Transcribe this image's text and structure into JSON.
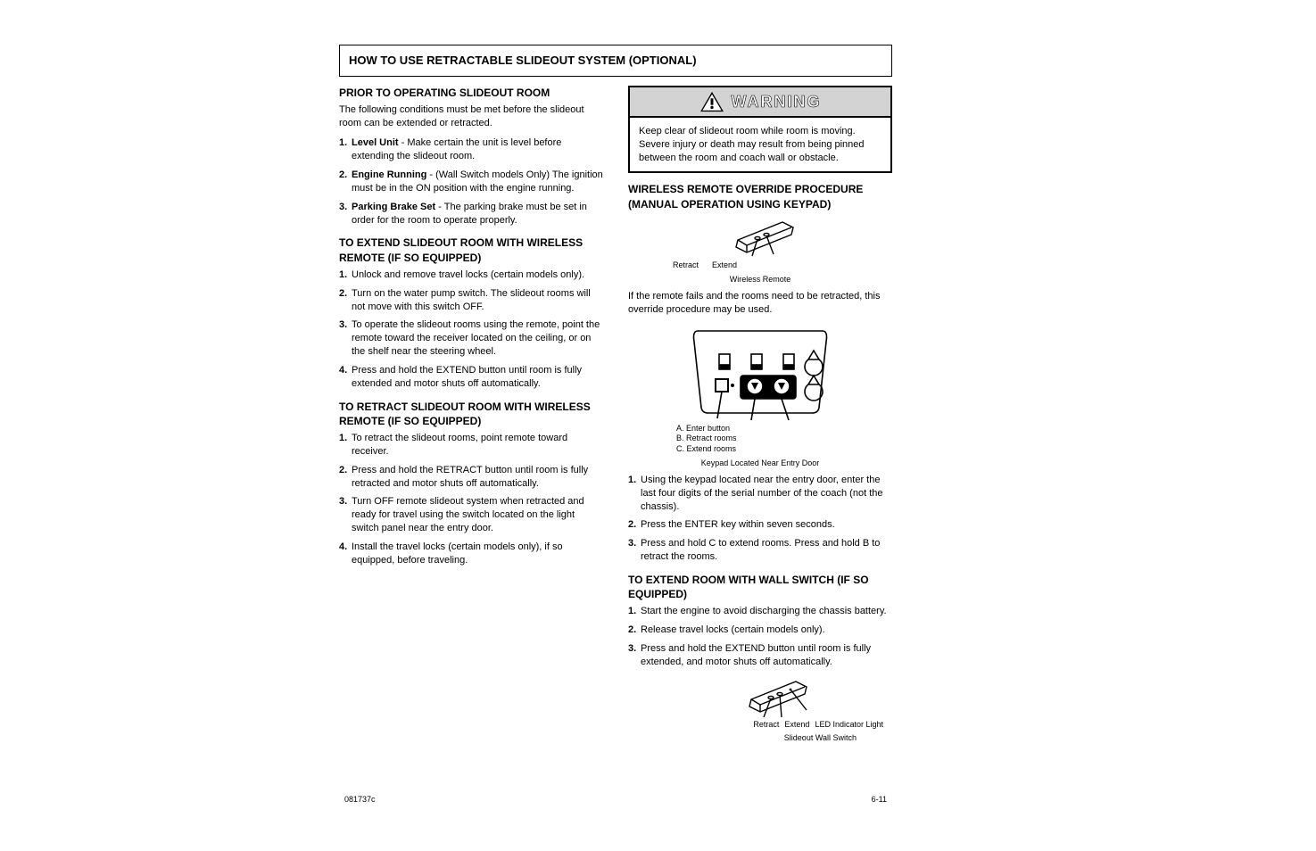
{
  "section_title": "HOW TO USE RETRACTABLE SLIDEOUT SYSTEM (OPTIONAL)",
  "left": {
    "prior_to_heading": "PRIOR TO OPERATING SLIDEOUT ROOM",
    "prior_to_body": "The following conditions must be met before the slideout room can be extended or retracted.",
    "prior_list": [
      {
        "bold": "Level Unit",
        "rest": " - Make certain the unit is level before extending the slideout room."
      },
      {
        "bold": "Engine Running",
        "rest": " - (Wall Switch models Only) The ignition must be in the ON position with the engine running."
      },
      {
        "bold": "Parking Brake Set",
        "rest": " - The parking brake must be set in order for the room to operate properly."
      }
    ],
    "extend_heading": "TO EXTEND SLIDEOUT ROOM WITH WIRELESS REMOTE (IF SO EQUIPPED)",
    "extend_list": [
      "Unlock and remove travel locks (certain models only).",
      "Turn on the water pump switch. The slideout rooms will not move with this switch OFF.",
      "To operate the slideout rooms using the remote, point the remote toward the receiver located on the ceiling, or on the shelf near the steering wheel.",
      "Press and hold the EXTEND button until room is fully extended and motor shuts off automatically."
    ],
    "retract_heading": "TO RETRACT SLIDEOUT ROOM WITH WIRELESS REMOTE (IF SO EQUIPPED)",
    "retract_list": [
      "To retract the slideout rooms, point remote toward receiver.",
      "Press and hold the RETRACT button until room is fully retracted and motor shuts off automatically.",
      "Turn OFF remote slideout system when retracted and ready for travel using the switch located on the light switch panel near the entry door.",
      "Install the travel locks (certain models only), if so equipped, before traveling."
    ]
  },
  "right": {
    "warning_label": "WARNING",
    "warning_body": "Keep clear of slideout room while room is moving. Severe injury or death may result from being pinned between the room and coach wall or obstacle.",
    "override_heading": "WIRELESS REMOTE OVERRIDE PROCEDURE (MANUAL OPERATION USING KEYPAD)",
    "remote_caption_extend": "Extend",
    "remote_caption_retract": "Retract",
    "remote_small_note": "Wireless Remote",
    "override_intro": "If the remote fails and the rooms need to be retracted, this override procedure may be used.",
    "keypad_labels": {
      "a": "A. Enter button",
      "b": "B. Retract rooms",
      "c": "C. Extend rooms"
    },
    "keypad_caption": "Keypad Located Near Entry Door",
    "override_list": [
      "Using the keypad located near the entry door, enter the last four digits of the serial number of the coach (not the chassis).",
      "Press the ENTER key within seven seconds.",
      "Press and hold C to extend rooms. Press and hold B to retract the rooms."
    ],
    "wall_heading": "TO EXTEND ROOM WITH WALL SWITCH (IF SO EQUIPPED)",
    "wall_list": [
      "Start the engine to avoid discharging the chassis battery.",
      "Release travel locks (certain models only).",
      "Press and hold the EXTEND button until room is fully extended, and motor shuts off automatically."
    ],
    "wall_caption_extend": "Extend",
    "wall_caption_retract": "Retract",
    "wall_caption_led": "LED Indicator Light",
    "wall_switch_note": "Slideout Wall Switch"
  },
  "footer": {
    "left": "081737c",
    "right": "6-11"
  },
  "icons": {
    "warning_triangle": "warning-triangle-icon"
  }
}
